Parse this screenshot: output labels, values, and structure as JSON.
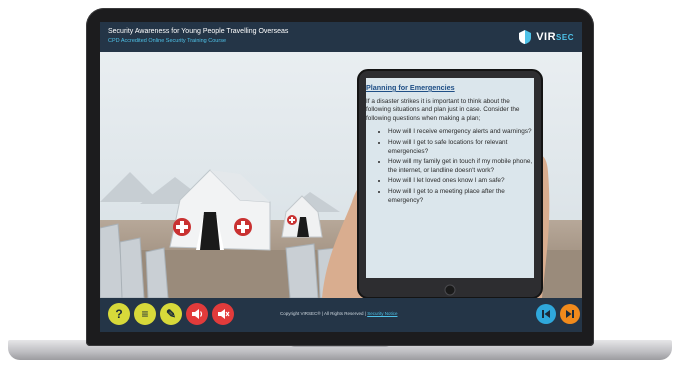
{
  "header": {
    "title": "Security Awareness for Young People Travelling Overseas",
    "subtitle": "CPD Accredited Online Security Training Course",
    "logo_text": "VIR",
    "logo_suffix": "SEC",
    "logo_mark": "®"
  },
  "tablet": {
    "heading": "Planning for Emergencies",
    "intro": "If a disaster strikes it is important to think about the following situations and plan just in case. Consider the following questions when making a plan;",
    "questions": [
      "How will I receive emergency alerts and warnings?",
      "How will I get to safe locations for relevant emergencies?",
      "How will my family get in touch if my mobile phone, the internet, or landline doesn't work?",
      "How will I let loved ones know I am safe?",
      "How will I get to a meeting place after the emergency?"
    ]
  },
  "footer": {
    "copyright": "Copyright VIRSEC® | All Rights Reserved |",
    "link": "Security Notice",
    "controls": [
      {
        "icon": "help-icon",
        "glyph": "?",
        "color": "#d7d93a"
      },
      {
        "icon": "menu-list-icon",
        "glyph": "≡",
        "color": "#d7d93a"
      },
      {
        "icon": "pencil-icon",
        "glyph": "✎",
        "color": "#d7d93a"
      },
      {
        "icon": "audio-icon",
        "glyph": "",
        "color": "#e23b3b"
      },
      {
        "icon": "mute-icon",
        "glyph": "",
        "color": "#e23b3b"
      }
    ],
    "prev_color": "#2fa8dc",
    "next_color": "#f08a1c"
  }
}
